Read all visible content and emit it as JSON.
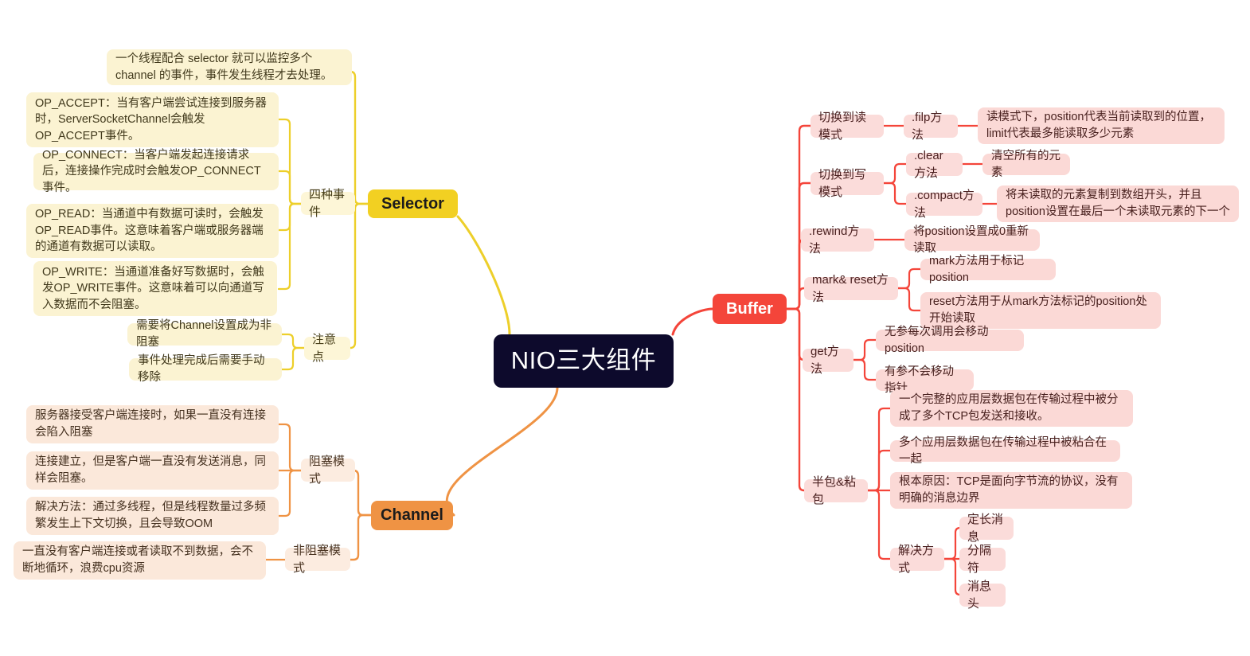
{
  "title": "NIO三大组件",
  "colors": {
    "background": "#ffffff",
    "root_bg": "#0d0a2c",
    "root_text": "#ffffff",
    "selector": "#f2d022",
    "channel": "#ef9344",
    "buffer": "#f4453a",
    "selector_leaf": "#fbf3d2",
    "channel_leaf": "#fbe8da",
    "buffer_leaf": "#fbd9d6"
  },
  "root": {
    "label": "NIO三大组件"
  },
  "branches": {
    "selector": {
      "label": "Selector",
      "topics": [
        {
          "label": "四种事件"
        },
        {
          "label": "注意点"
        }
      ],
      "intro": "一个线程配合 selector 就可以监控多个 channel 的事件，事件发生线程才去处理。",
      "events": [
        "OP_ACCEPT：当有客户端尝试连接到服务器时，ServerSocketChannel会触发OP_ACCEPT事件。",
        "OP_CONNECT：当客户端发起连接请求后，连接操作完成时会触发OP_CONNECT事件。",
        "OP_READ：当通道中有数据可读时，会触发OP_READ事件。这意味着客户端或服务器端的通道有数据可以读取。",
        "OP_WRITE：当通道准备好写数据时，会触发OP_WRITE事件。这意味着可以向通道写入数据而不会阻塞。"
      ],
      "notes": [
        "需要将Channel设置成为非阻塞",
        "事件处理完成后需要手动移除"
      ]
    },
    "channel": {
      "label": "Channel",
      "topics": [
        {
          "label": "阻塞模式"
        },
        {
          "label": "非阻塞模式"
        }
      ],
      "blocking": [
        "服务器接受客户端连接时，如果一直没有连接会陷入阻塞",
        "连接建立，但是客户端一直没有发送消息，同样会阻塞。",
        "解决方法：通过多线程，但是线程数量过多频繁发生上下文切换，且会导致OOM"
      ],
      "nonblocking": [
        "一直没有客户端连接或者读取不到数据，会不断地循环，浪费cpu资源"
      ]
    },
    "buffer": {
      "label": "Buffer",
      "topics": [
        {
          "label": "切换到读模式"
        },
        {
          "label": "切换到写模式"
        },
        {
          "label": ".rewind方法"
        },
        {
          "label": "mark& reset方法"
        },
        {
          "label": "get方法"
        },
        {
          "label": "半包&粘包"
        }
      ],
      "read_mode": {
        "method": ".filp方法",
        "desc": "读模式下，position代表当前读取到的位置，limit代表最多能读取多少元素"
      },
      "write_mode": {
        "methods": [
          {
            "method": ".clear方法",
            "desc": "清空所有的元素"
          },
          {
            "method": ".compact方法",
            "desc": "将未读取的元素复制到数组开头，并且position设置在最后一个未读取元素的下一个"
          }
        ]
      },
      "rewind_desc": "将position设置成0重新读取",
      "mark_reset": [
        "mark方法用于标记position",
        "reset方法用于从mark方法标记的position处开始读取"
      ],
      "get_method": [
        "无参每次调用会移动position",
        "有参不会移动指针"
      ],
      "halfpacket": [
        "一个完整的应用层数据包在传输过程中被分成了多个TCP包发送和接收。",
        "多个应用层数据包在传输过程中被粘合在一起",
        "根本原因：TCP是面向字节流的协议，没有明确的消息边界"
      ],
      "solution": {
        "label": "解决方式",
        "items": [
          "定长消息",
          "分隔符",
          "消息头"
        ]
      }
    }
  }
}
